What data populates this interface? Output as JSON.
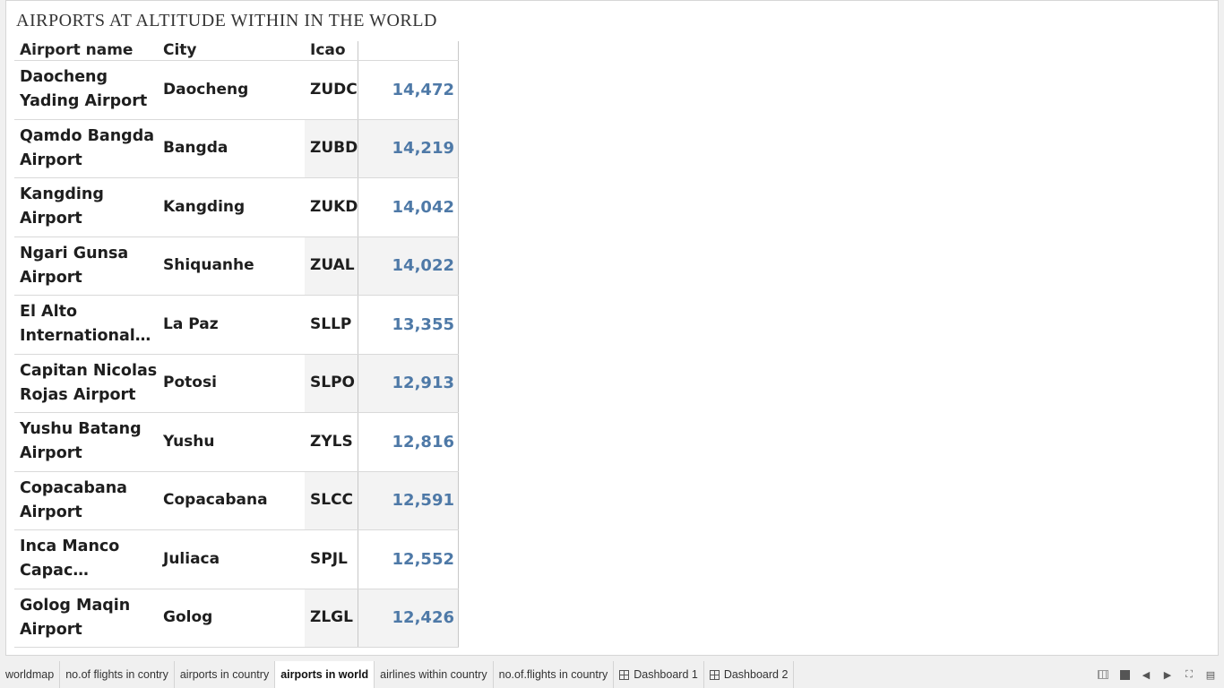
{
  "title": "AIRPORTS AT ALTITUDE WITHIN IN THE WORLD",
  "table": {
    "headers": [
      "Airport name",
      "City",
      "Icao",
      ""
    ],
    "rows": [
      {
        "name": "Daocheng Yading Airport",
        "city": "Daocheng",
        "icao": "ZUDC",
        "altitude": "14,472"
      },
      {
        "name": "Qamdo Bangda Airport",
        "city": "Bangda",
        "icao": "ZUBD",
        "altitude": "14,219"
      },
      {
        "name": "Kangding Airport",
        "city": "Kangding",
        "icao": "ZUKD",
        "altitude": "14,042"
      },
      {
        "name": "Ngari Gunsa Airport",
        "city": "Shiquanhe",
        "icao": "ZUAL",
        "altitude": "14,022"
      },
      {
        "name": "El Alto International A..",
        "city": "La Paz",
        "icao": "SLLP",
        "altitude": "13,355"
      },
      {
        "name": "Capitan Nicolas Rojas Airport",
        "city": "Potosi",
        "icao": "SLPO",
        "altitude": "12,913"
      },
      {
        "name": "Yushu Batang Airport",
        "city": "Yushu",
        "icao": "ZYLS",
        "altitude": "12,816"
      },
      {
        "name": "Copacabana Airport",
        "city": "Copacabana",
        "icao": "SLCC",
        "altitude": "12,591"
      },
      {
        "name": "Inca Manco Capac Internat..",
        "city": "Juliaca",
        "icao": "SPJL",
        "altitude": "12,552"
      },
      {
        "name": "Golog Maqin Airport",
        "city": "Golog",
        "icao": "ZLGL",
        "altitude": "12,426"
      }
    ]
  },
  "tabs": [
    {
      "label": "worldmap",
      "active": false,
      "icon": ""
    },
    {
      "label": "no.of flights in contry",
      "active": false,
      "icon": ""
    },
    {
      "label": "airports in country",
      "active": false,
      "icon": ""
    },
    {
      "label": "airports in world",
      "active": true,
      "icon": ""
    },
    {
      "label": "airlines within country",
      "active": false,
      "icon": ""
    },
    {
      "label": "no.of.flights in country",
      "active": false,
      "icon": ""
    },
    {
      "label": "Dashboard 1",
      "active": false,
      "icon": "dashboard-icon"
    },
    {
      "label": "Dashboard 2",
      "active": false,
      "icon": "dashboard-icon"
    }
  ],
  "colors": {
    "value_text": "#4e79a7",
    "band": "#f3f3f3"
  }
}
